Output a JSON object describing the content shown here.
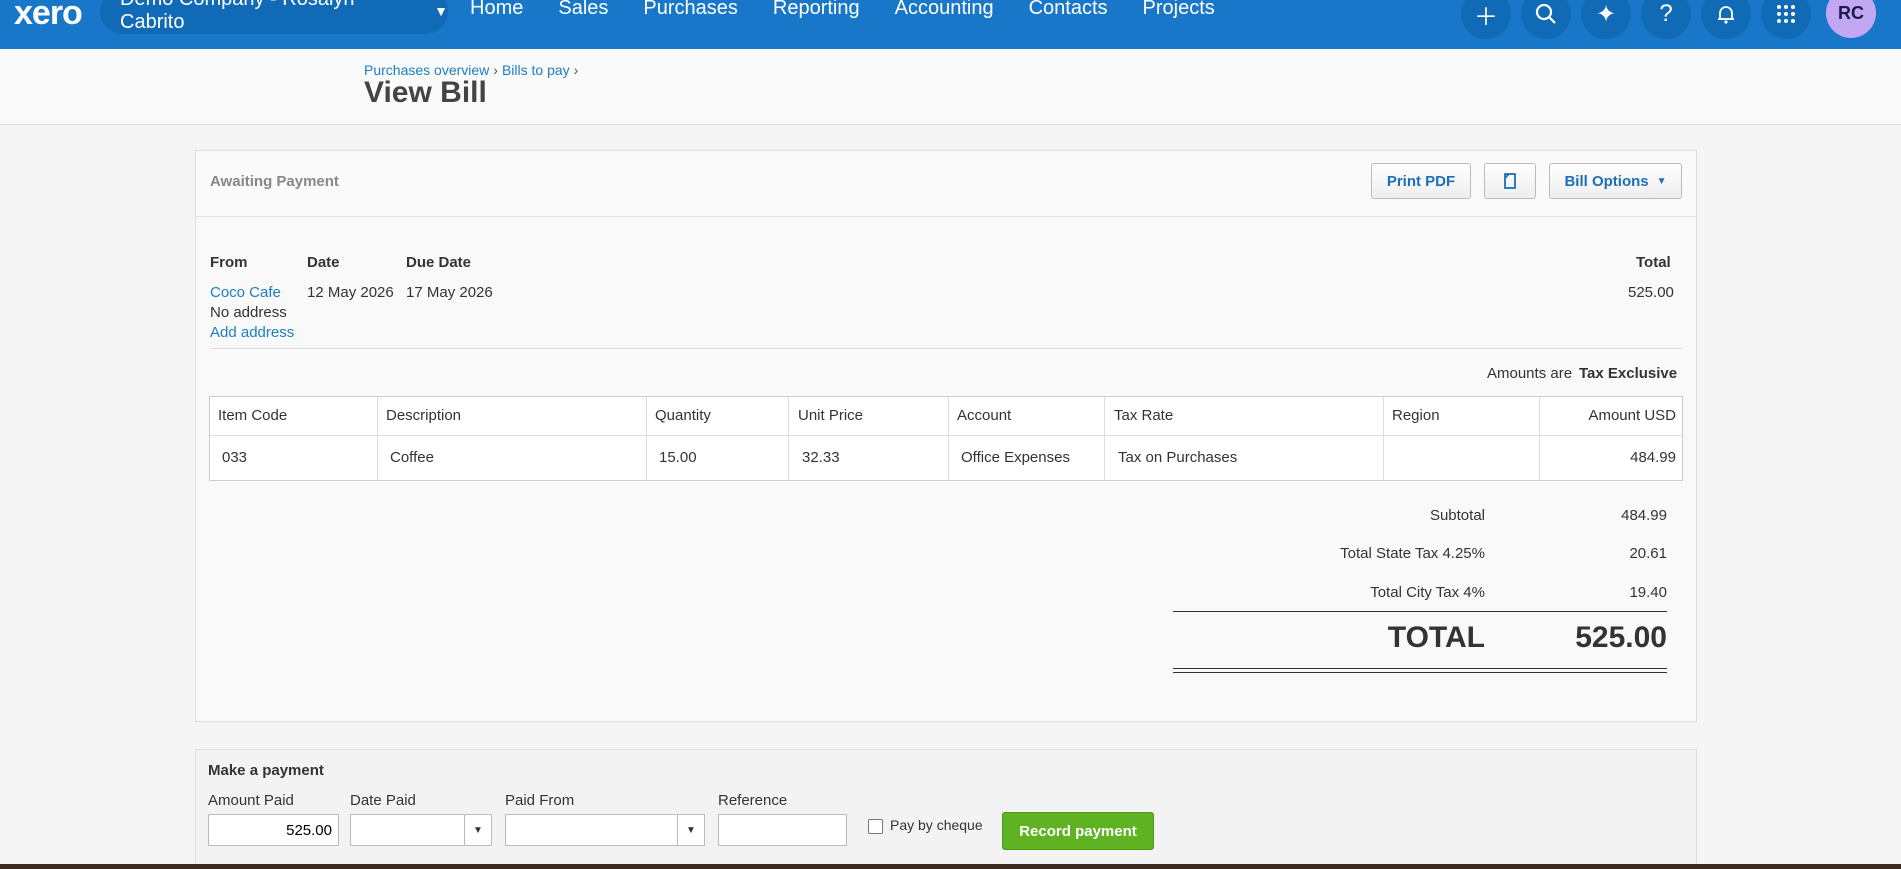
{
  "topbar": {
    "logo": "xero",
    "org_name": "Demo Company - Rosalyn Cabrito",
    "nav": [
      "Home",
      "Sales",
      "Purchases",
      "Reporting",
      "Accounting",
      "Contacts",
      "Projects"
    ],
    "icons": [
      "plus-icon",
      "search-icon",
      "sparkle-icon",
      "help-icon",
      "bell-icon",
      "apps-grid-icon"
    ],
    "avatar_initials": "RC"
  },
  "header": {
    "breadcrumb": [
      "Purchases overview",
      "Bills to pay"
    ],
    "title": "View Bill"
  },
  "bill": {
    "status": "Awaiting Payment",
    "print_pdf": "Print PDF",
    "bill_options": "Bill Options",
    "from_label": "From",
    "date_label": "Date",
    "due_label": "Due Date",
    "total_label": "Total",
    "from_name": "Coco Cafe",
    "no_address": "No address",
    "add_address": "Add address",
    "date": "12 May 2026",
    "due_date": "17 May 2026",
    "total": "525.00",
    "amounts_are_label": "Amounts are",
    "amounts_are_value": "Tax Exclusive"
  },
  "table": {
    "headers": [
      "Item Code",
      "Description",
      "Quantity",
      "Unit Price",
      "Account",
      "Tax Rate",
      "Region",
      "Amount USD"
    ],
    "rows": [
      [
        "033",
        "Coffee",
        "15.00",
        "32.33",
        "Office Expenses",
        "Tax on Purchases",
        "",
        "484.99"
      ]
    ]
  },
  "totals": {
    "subtotal_label": "Subtotal",
    "subtotal": "484.99",
    "state_tax_label": "Total State Tax 4.25%",
    "state_tax": "20.61",
    "city_tax_label": "Total City Tax 4%",
    "city_tax": "19.40",
    "total_label": "TOTAL",
    "total": "525.00"
  },
  "payment": {
    "title": "Make a payment",
    "amount_label": "Amount Paid",
    "amount_value": "525.00",
    "date_label": "Date Paid",
    "paid_from_label": "Paid From",
    "reference_label": "Reference",
    "cheque_label": "Pay by cheque",
    "record_button": "Record payment"
  },
  "colors": {
    "topbar": "#1977c9",
    "link": "#1c7ec4",
    "record": "#5fb322"
  }
}
